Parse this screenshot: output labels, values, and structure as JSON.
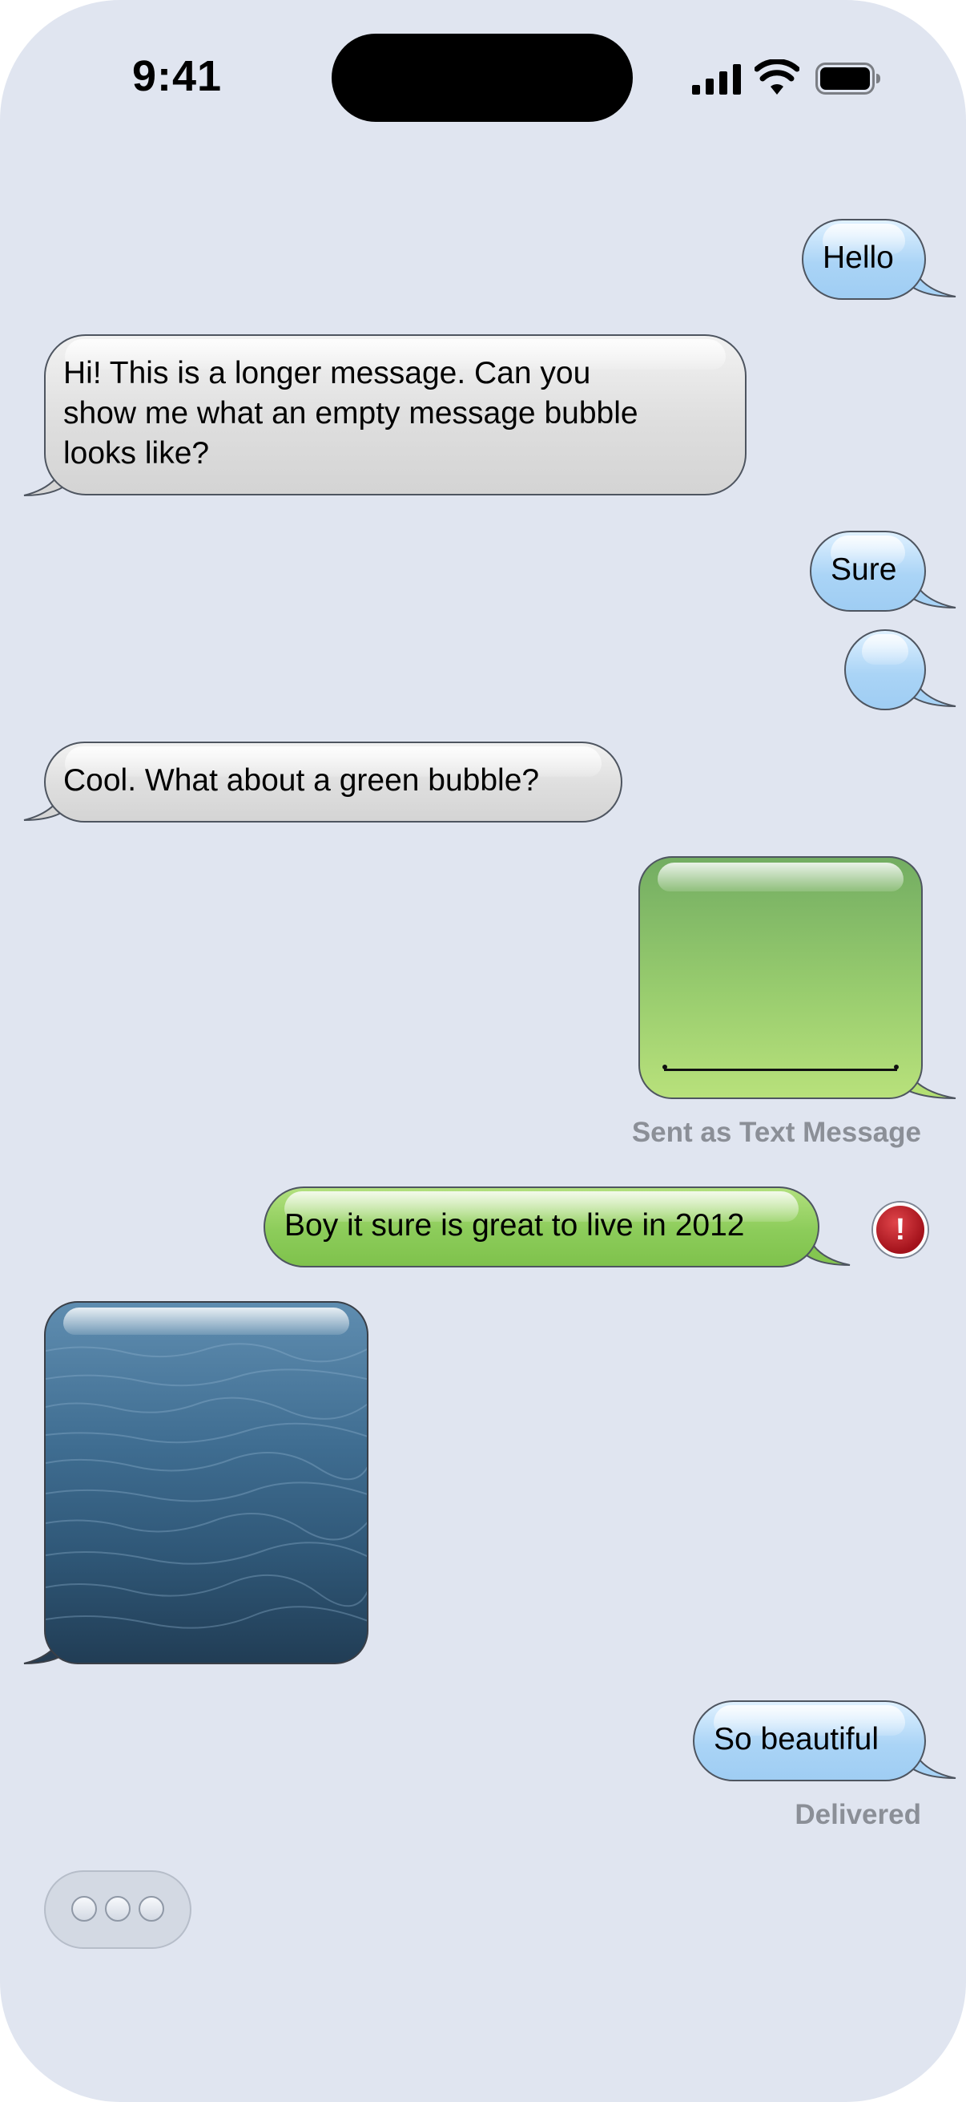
{
  "status_bar": {
    "time": "9:41"
  },
  "messages": [
    {
      "text": "Hello",
      "side": "sent",
      "color": "blue"
    },
    {
      "text": "Hi! This is a longer message. Can you show me what an empty message bubble looks like?",
      "lines": [
        "Hi! This is a longer message. Can you",
        "show me what an empty message bubble",
        "looks like?"
      ],
      "side": "received",
      "color": "gray"
    },
    {
      "text": "Sure",
      "side": "sent",
      "color": "blue"
    },
    {
      "text": "",
      "side": "sent",
      "color": "blue"
    },
    {
      "text": "Cool. What about a green bubble?",
      "side": "received",
      "color": "gray"
    },
    {
      "text": "",
      "side": "sent",
      "color": "green",
      "note": "Sent as Text Message"
    },
    {
      "text": "Boy it sure is great to live in 2012",
      "side": "sent",
      "color": "green",
      "error": "!"
    },
    {
      "text": "",
      "side": "received",
      "color": "image"
    },
    {
      "text": "So beautiful",
      "side": "sent",
      "color": "blue",
      "note": "Delivered"
    }
  ],
  "colors": {
    "background": "#e0e5f0",
    "blue_bubble": "#aad4f6",
    "gray_bubble": "#dedede",
    "green_bubble": "#8ccc5a",
    "error": "#a3121b"
  }
}
